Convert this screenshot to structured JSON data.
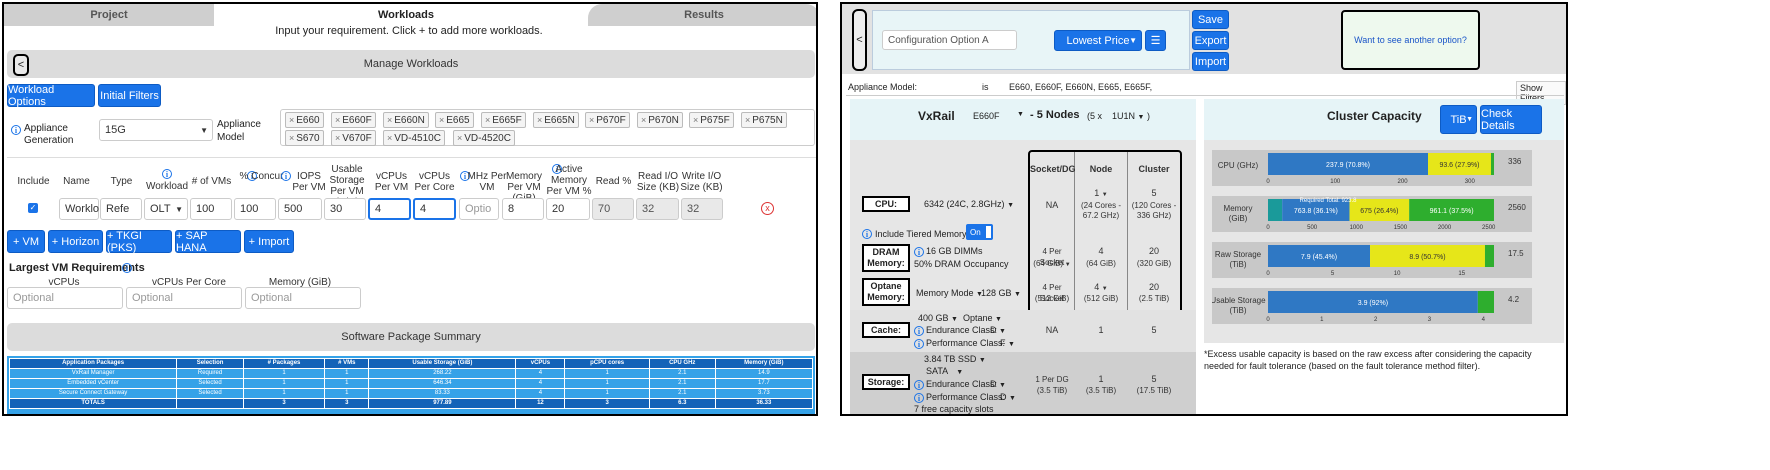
{
  "tabs": [
    "Project",
    "Workloads",
    "Results"
  ],
  "instruction": "Input your requirement. Click + to add more workloads.",
  "manage": {
    "back": "<",
    "title": "Manage Workloads"
  },
  "filters": {
    "workload_options": "Workload Options",
    "initial_filters": "Initial Filters"
  },
  "appliance": {
    "gen_label": "Appliance Generation",
    "gen_value": "15G",
    "model_label": "Appliance Model",
    "models": [
      "E660",
      "E660F",
      "E660N",
      "E665",
      "E665F",
      "E665N",
      "P670F",
      "P670N",
      "P675F",
      "P675N",
      "S670",
      "V670F",
      "VD-4510C",
      "VD-4520C"
    ]
  },
  "wl_headers": {
    "include": "Include",
    "name": "Name",
    "type": "Type",
    "workload": "Workload",
    "vms": "# of VMs",
    "concur": "% Concur",
    "iops": "IOPS Per VM",
    "usable": "Usable Storage Per VM (GiB)",
    "vcpus": "vCPUs Per VM",
    "vcpus_core": "vCPUs Per Core",
    "mhz": "MHz Per VM",
    "mem": "Memory Per VM (GiB)",
    "active_mem": "Active Memory Per VM %",
    "read": "Read %",
    "read_io": "Read I/O Size (KB)",
    "write_io": "Write I/O Size (KB)"
  },
  "wl_row": {
    "name": "Worklo",
    "type": "Refe",
    "workload": "OLT",
    "vms": "100",
    "concur": "100",
    "iops": "500",
    "usable": "30",
    "vcpus": "4",
    "vcpus_core": "4",
    "mhz": "Optio",
    "mem": "8",
    "active_mem": "20",
    "read": "70",
    "read_io": "32",
    "write_io": "32",
    "remove": "x"
  },
  "add_buttons": [
    "+ VM",
    "+ Horizon",
    "+ TKGI (PKS)",
    "+ SAP HANA",
    "+ Import"
  ],
  "largest": {
    "title": "Largest VM Requirements",
    "vcpus": "vCPUs",
    "vcpus_core": "vCPUs Per Core",
    "mem": "Memory (GiB)",
    "placeholder": "Optional"
  },
  "software_summary": "Software Package Summary",
  "pkg_table": {
    "headers": [
      "Application Packages",
      "Selection",
      "# Packages",
      "# VMs",
      "Usable Storage (GiB)",
      "vCPUs",
      "pCPU cores",
      "CPU GHz",
      "Memory (GiB)"
    ],
    "rows": [
      [
        "VxRail Manager",
        "Required",
        "1",
        "1",
        "268.22",
        "4",
        "1",
        "2.1",
        "14.9"
      ],
      [
        "Embedded vCenter",
        "Selected",
        "1",
        "1",
        "646.34",
        "4",
        "1",
        "2.1",
        "17.7"
      ],
      [
        "Secure Connect Gateway",
        "Selected",
        "1",
        "1",
        "83.33",
        "4",
        "1",
        "2.1",
        "3.73"
      ]
    ],
    "total": [
      "TOTALS",
      "",
      "3",
      "3",
      "977.89",
      "12",
      "3",
      "6.3",
      "36.33"
    ]
  },
  "config": {
    "back": "<",
    "name": "Configuration Option A",
    "sort": "Lowest Price",
    "menu_icon": "☰",
    "save": "Save",
    "export": "Export",
    "import": "Import",
    "another": "Want to see another option?"
  },
  "model_line": {
    "label": "Appliance Model:",
    "op": "is",
    "value": "E660, E660F, E660N, E665, E665F,",
    "show": "Show Filters"
  },
  "vx": {
    "brand": "VxRail",
    "model": "E660F",
    "nodes": "- 5 Nodes",
    "nodes_detail": "(5 x",
    "form": "1U1N",
    "col_socket": "Socket/DG",
    "col_node": "Node",
    "col_cluster": "Cluster",
    "cpu_label": "CPU:",
    "cpu_value": "6342 (24C, 2.8GHz)",
    "cpu_socket": "NA",
    "cpu_node": "1",
    "cpu_node_sub": "(24 Cores - 67.2 GHz)",
    "cpu_cluster": "5",
    "cpu_cluster_sub": "(120 Cores - 336 GHz)",
    "tiered": "Include Tiered Memory",
    "tiered_toggle": "On",
    "dram_label": "DRAM Memory:",
    "dram_value": "16 GB DIMMs",
    "dram_occ": "50% DRAM Occupancy",
    "dram_socket": "4 Per Socket",
    "dram_socket_sub": "(64 GiB)",
    "dram_node": "4",
    "dram_node_sub": "(64 GiB)",
    "dram_cluster": "20",
    "dram_cluster_sub": "(320 GiB)",
    "optane_label": "Optane Memory:",
    "optane_mode": "Memory Mode",
    "optane_size": "128 GB",
    "optane_socket": "4 Per Socket",
    "optane_socket_sub": "(512 GiB)",
    "optane_node": "4",
    "optane_node_sub": "(512 GiB)",
    "optane_cluster": "20",
    "optane_cluster_sub": "(2.5 TiB)",
    "cache_label": "Cache:",
    "cache_size": "400 GB",
    "cache_type": "Optane",
    "cache_end": "Endurance Class:",
    "cache_end_v": "D",
    "cache_perf": "Performance Class:",
    "cache_perf_v": "F",
    "cache_socket": "NA",
    "cache_node": "1",
    "cache_cluster": "5",
    "storage_label": "Storage:",
    "storage_size": "3.84 TB SSD",
    "storage_if": "SATA",
    "storage_end": "Endurance Class:",
    "storage_end_v": "D",
    "storage_perf": "Performance Class:",
    "storage_perf_v": "D",
    "storage_slots": "7 free capacity slots",
    "storage_socket": "1 Per DG",
    "storage_socket_sub": "(3.5 TiB)",
    "storage_node": "1",
    "storage_node_sub": "(3.5 TiB)",
    "storage_cluster": "5",
    "storage_cluster_sub": "(17.5 TiB)"
  },
  "cluster": {
    "title": "Cluster Capacity",
    "unit": "TiB",
    "check": "Check Details",
    "footnote": "*Excess usable capacity is based on the raw excess after considering the capacity needed for fault tolerance (based on the fault tolerance method filter)."
  },
  "chart_data": [
    {
      "type": "bar",
      "title": "CPU (GHz)",
      "max_label": "336",
      "xlim": [
        0,
        336
      ],
      "ticks": [
        "0",
        "100",
        "200",
        "300"
      ],
      "segments": [
        {
          "label": "237.9 (70.8%)",
          "value": 237.9,
          "color": "#2f78c4"
        },
        {
          "label": "93.6 (27.9%)",
          "value": 93.6,
          "color": "#e6e619"
        },
        {
          "label": "",
          "value": 4.5,
          "color": "#2eae2e"
        }
      ]
    },
    {
      "type": "bar",
      "title": "Memory (GiB)",
      "max_label": "2560",
      "xlim": [
        0,
        2560
      ],
      "ticks": [
        "0",
        "500",
        "1000",
        "1500",
        "2000",
        "2500"
      ],
      "annotation": "Required Total: 923.8",
      "segments": [
        {
          "label": "160",
          "value": 160,
          "color": "#1a9a9a"
        },
        {
          "label": "763.8 (36.1%)",
          "value": 763.8,
          "color": "#2f78c4"
        },
        {
          "label": "675 (26.4%)",
          "value": 675,
          "color": "#e6e619"
        },
        {
          "label": "961.1 (37.5%)",
          "value": 961.1,
          "color": "#2eae2e"
        }
      ]
    },
    {
      "type": "bar",
      "title": "Raw Storage (TiB)",
      "max_label": "17.5",
      "xlim": [
        0,
        17.5
      ],
      "ticks": [
        "0",
        "5",
        "10",
        "15",
        "20"
      ],
      "segments": [
        {
          "label": "7.9 (45.4%)",
          "value": 7.9,
          "color": "#2f78c4"
        },
        {
          "label": "8.9 (50.7%)",
          "value": 8.9,
          "color": "#e6e619"
        },
        {
          "label": "0.7 (3.9%)",
          "value": 0.7,
          "color": "#2eae2e"
        }
      ]
    },
    {
      "type": "bar",
      "title": "Usable Storage (TiB)",
      "max_label": "4.2",
      "xlim": [
        0,
        4.2
      ],
      "ticks": [
        "0",
        "1",
        "2",
        "3",
        "4"
      ],
      "segments": [
        {
          "label": "3.9 (92%)",
          "value": 3.9,
          "color": "#2f78c4"
        },
        {
          "label": "0.3 (8%)",
          "value": 0.3,
          "color": "#2eae2e"
        }
      ]
    }
  ]
}
